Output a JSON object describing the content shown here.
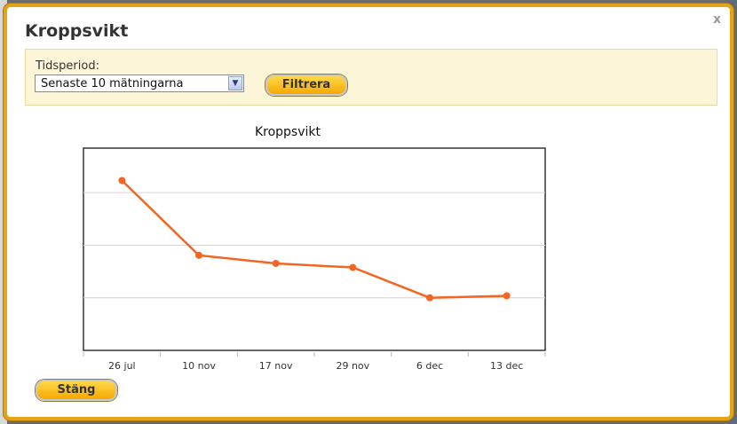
{
  "dialog": {
    "title": "Kroppsvikt",
    "close_label": "x"
  },
  "filter": {
    "label": "Tidsperiod:",
    "selected_option": "Senaste 10 mätningarna",
    "button_label": "Filtrera"
  },
  "footer": {
    "close_button_label": "Stäng"
  },
  "colors": {
    "accent_border": "#e3a516",
    "series_line": "#f26522"
  },
  "chart_data": {
    "type": "line",
    "title": "Kroppsvikt",
    "categories": [
      "26 jul",
      "10 nov",
      "17 nov",
      "29 nov",
      "6 dec",
      "13 dec"
    ],
    "series": [
      {
        "values": [
          4.2,
          2.35,
          2.15,
          2.05,
          1.3,
          1.35
        ]
      }
    ],
    "ylim": [
      0,
      5
    ],
    "grid": true,
    "y_tick_labels_visible": false
  }
}
